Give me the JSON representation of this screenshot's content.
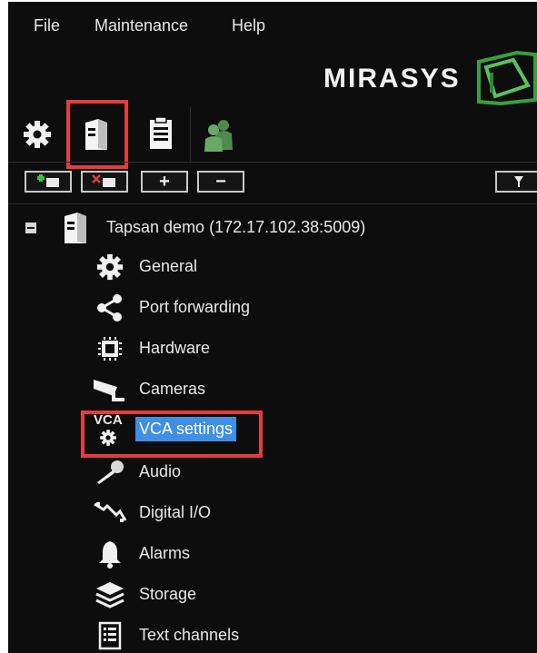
{
  "menu": {
    "file": "File",
    "maintenance": "Maintenance",
    "help": "Help"
  },
  "logo": {
    "text": "MIRASYS"
  },
  "tabs": [
    {
      "name": "settings",
      "icon": "gear-icon",
      "selected": false
    },
    {
      "name": "servers",
      "icon": "server-icon",
      "selected": true
    },
    {
      "name": "profiles",
      "icon": "clipboard-icon",
      "selected": false
    },
    {
      "name": "users",
      "icon": "users-icon",
      "selected": false
    }
  ],
  "toolbar": {
    "add_server": "add-server-icon",
    "remove_server": "remove-server-icon",
    "expand": "+",
    "collapse": "−"
  },
  "tree": {
    "root_label": "Tapsan demo (172.17.102.38:5009)",
    "vca_badge": "VCA",
    "items": [
      {
        "label": "General",
        "icon": "gear-icon"
      },
      {
        "label": "Port forwarding",
        "icon": "share-icon"
      },
      {
        "label": "Hardware",
        "icon": "chip-icon"
      },
      {
        "label": "Cameras",
        "icon": "camera-icon"
      },
      {
        "label": "VCA settings",
        "icon": "vca-gear-icon",
        "selected": true
      },
      {
        "label": "Audio",
        "icon": "microphone-icon"
      },
      {
        "label": "Digital I/O",
        "icon": "digital-io-icon"
      },
      {
        "label": "Alarms",
        "icon": "bell-icon"
      },
      {
        "label": "Storage",
        "icon": "layers-icon"
      },
      {
        "label": "Text channels",
        "icon": "text-channel-icon"
      }
    ]
  },
  "colors": {
    "highlight": "#e63c3c",
    "selection": "#3f8fe4",
    "background": "#0d0d0d"
  }
}
